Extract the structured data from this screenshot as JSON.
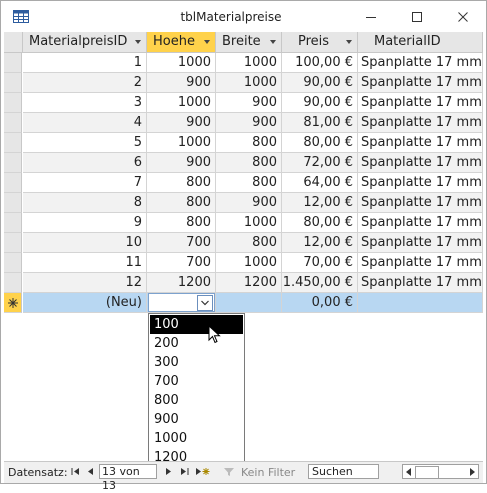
{
  "window": {
    "title": "tblMaterialpreise"
  },
  "columns": [
    {
      "label": "MaterialpreisID"
    },
    {
      "label": "Hoehe"
    },
    {
      "label": "Breite"
    },
    {
      "label": "Preis"
    },
    {
      "label": "MaterialID"
    }
  ],
  "rows": [
    {
      "id": "1",
      "hoehe": "1000",
      "breite": "1000",
      "preis": "100,00 €",
      "material": "Spanplatte 17 mm"
    },
    {
      "id": "2",
      "hoehe": "900",
      "breite": "1000",
      "preis": "90,00 €",
      "material": "Spanplatte 17 mm"
    },
    {
      "id": "3",
      "hoehe": "1000",
      "breite": "900",
      "preis": "90,00 €",
      "material": "Spanplatte 17 mm"
    },
    {
      "id": "4",
      "hoehe": "900",
      "breite": "900",
      "preis": "81,00 €",
      "material": "Spanplatte 17 mm"
    },
    {
      "id": "5",
      "hoehe": "1000",
      "breite": "800",
      "preis": "80,00 €",
      "material": "Spanplatte 17 mm"
    },
    {
      "id": "6",
      "hoehe": "900",
      "breite": "800",
      "preis": "72,00 €",
      "material": "Spanplatte 17 mm"
    },
    {
      "id": "7",
      "hoehe": "800",
      "breite": "800",
      "preis": "64,00 €",
      "material": "Spanplatte 17 mm"
    },
    {
      "id": "8",
      "hoehe": "800",
      "breite": "900",
      "preis": "12,00 €",
      "material": "Spanplatte 17 mm"
    },
    {
      "id": "9",
      "hoehe": "800",
      "breite": "1000",
      "preis": "80,00 €",
      "material": "Spanplatte 17 mm"
    },
    {
      "id": "10",
      "hoehe": "700",
      "breite": "800",
      "preis": "12,00 €",
      "material": "Spanplatte 17 mm"
    },
    {
      "id": "11",
      "hoehe": "700",
      "breite": "1000",
      "preis": "70,00 €",
      "material": "Spanplatte 17 mm"
    },
    {
      "id": "12",
      "hoehe": "1200",
      "breite": "1200",
      "preis": "1.450,00 €",
      "material": "Spanplatte 17 mm"
    }
  ],
  "new_row": {
    "id": "(Neu)",
    "hoehe": "",
    "preis": "0,00 €"
  },
  "dropdown": {
    "options": [
      "100",
      "200",
      "300",
      "700",
      "800",
      "900",
      "1000",
      "1200"
    ],
    "highlighted": "100"
  },
  "status": {
    "record_label": "Datensatz:",
    "record_value": "13 von 13",
    "filter_label": "Kein Filter",
    "search_placeholder": "Suchen"
  },
  "colors": {
    "selected_header": "#ffd24b",
    "new_row": "#b8d7f2",
    "alt_row": "#f2f2f2"
  }
}
